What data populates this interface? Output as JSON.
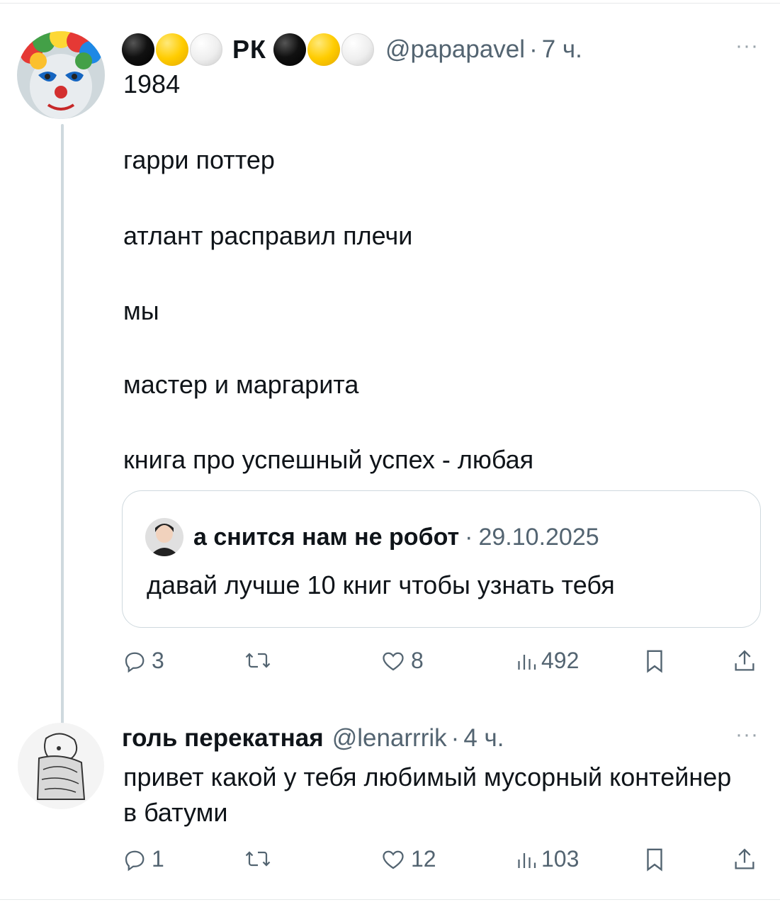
{
  "tweet1": {
    "avatar": "clown-avatar",
    "display_name": "РК",
    "handle": "@papapavel",
    "separator": "·",
    "time": "7 ч.",
    "more": "···",
    "text_lines": [
      "1984",
      "гарри поттер",
      "атлант расправил плечи",
      "мы",
      "мастер и маргарита",
      "книга про успешный успех - любая"
    ],
    "quote": {
      "name": "а снится нам не робот",
      "separator": "·",
      "date": "29.10.2025",
      "text": "давай лучше 10 книг чтобы узнать тебя"
    },
    "actions": {
      "replies": "3",
      "likes": "8",
      "views": "492"
    }
  },
  "tweet2": {
    "avatar": "sketch-avatar",
    "display_name": "голь перекатная",
    "handle": "@lenarrrik",
    "separator": "·",
    "time": "4 ч.",
    "more": "···",
    "text": "привет какой у тебя любимый мусорный контейнер в батуми",
    "actions": {
      "replies": "1",
      "likes": "12",
      "views": "103"
    }
  },
  "colors": {
    "text": "#0f1419",
    "secondary": "#536471",
    "border": "#cfd9de",
    "dot_black": "#000000",
    "dot_yellow": "#ffcc00",
    "dot_white": "#eeeeee"
  }
}
